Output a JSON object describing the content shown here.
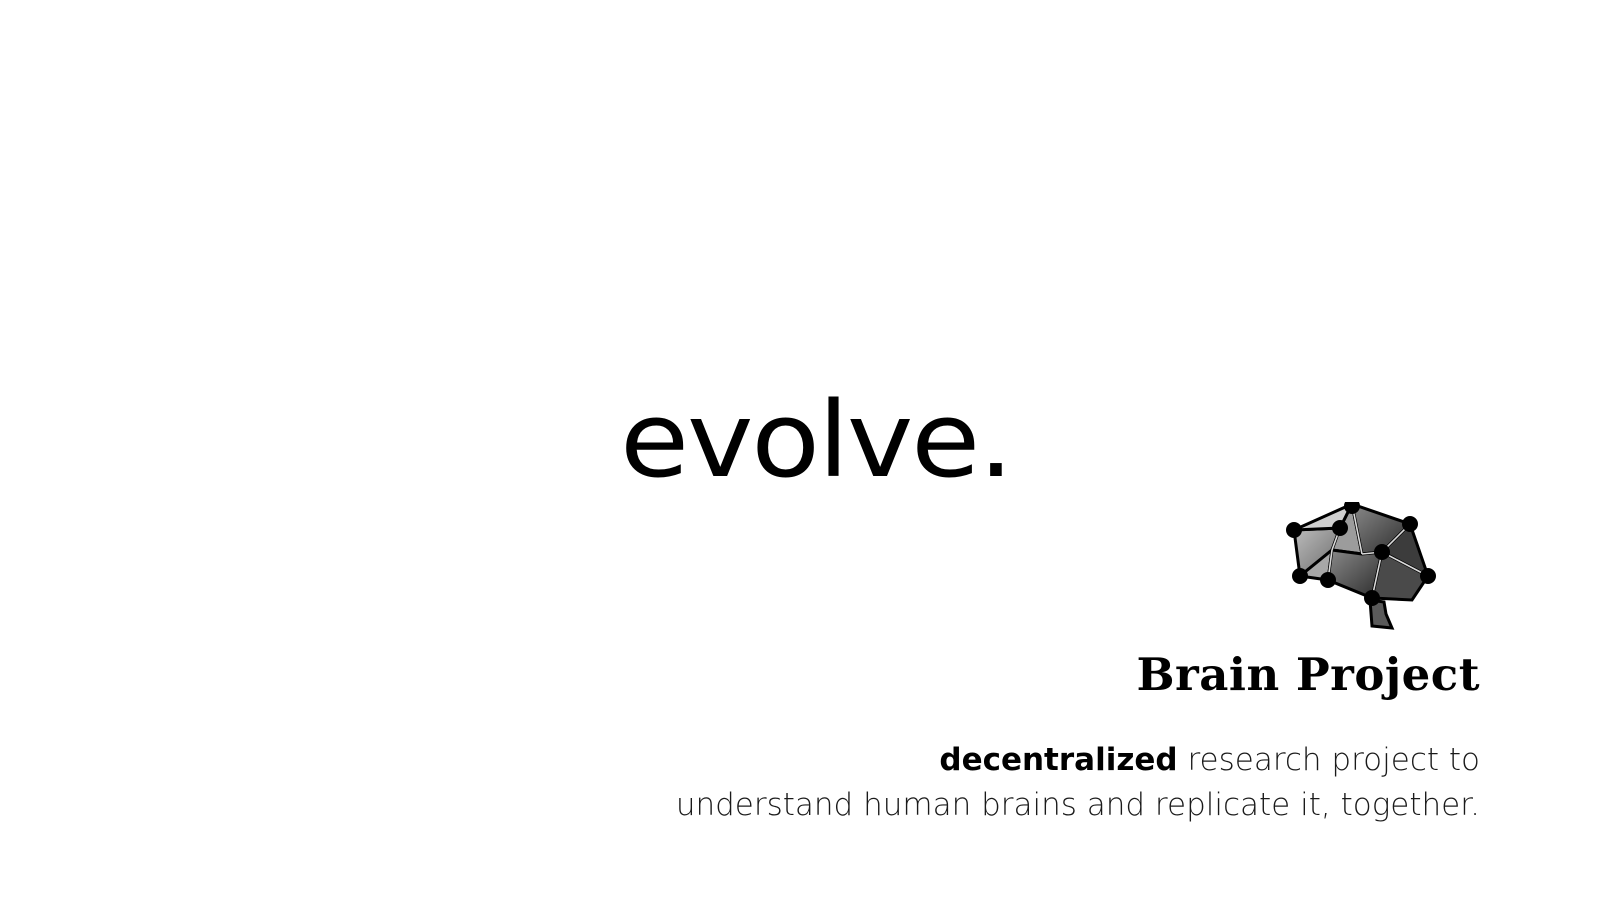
{
  "hero": {
    "word": "evolve."
  },
  "brand": {
    "logo_icon": "brain-network-icon",
    "name": "Brain Project"
  },
  "tagline": {
    "bold": "decentralized",
    "line1_rest": " research project to",
    "line2": "understand human brains and replicate it, together."
  }
}
